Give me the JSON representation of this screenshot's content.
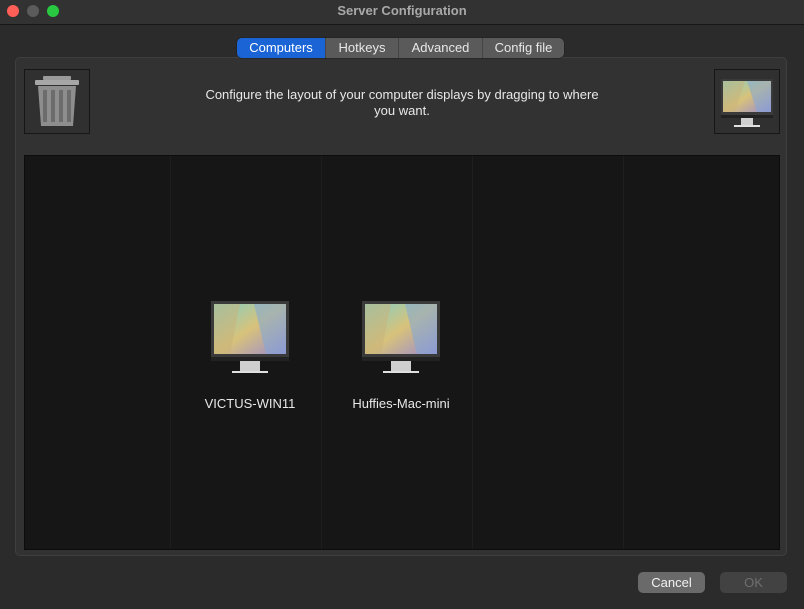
{
  "window": {
    "title": "Server Configuration"
  },
  "tabs": [
    {
      "label": "Computers",
      "active": true
    },
    {
      "label": "Hotkeys",
      "active": false
    },
    {
      "label": "Advanced",
      "active": false
    },
    {
      "label": "Config file",
      "active": false
    }
  ],
  "computers_tab": {
    "instruction": "Configure the layout of your computer displays by dragging to where you want.",
    "trash_icon": "trash-icon",
    "new_screen_icon": "monitor-icon",
    "screens": [
      {
        "name": "VICTUS-WIN11"
      },
      {
        "name": "Huffies-Mac-mini"
      }
    ]
  },
  "buttons": {
    "cancel": "Cancel",
    "ok": "OK"
  },
  "colors": {
    "accent": "#1a64d6",
    "close": "#ff5f57",
    "maximize": "#28c840"
  }
}
